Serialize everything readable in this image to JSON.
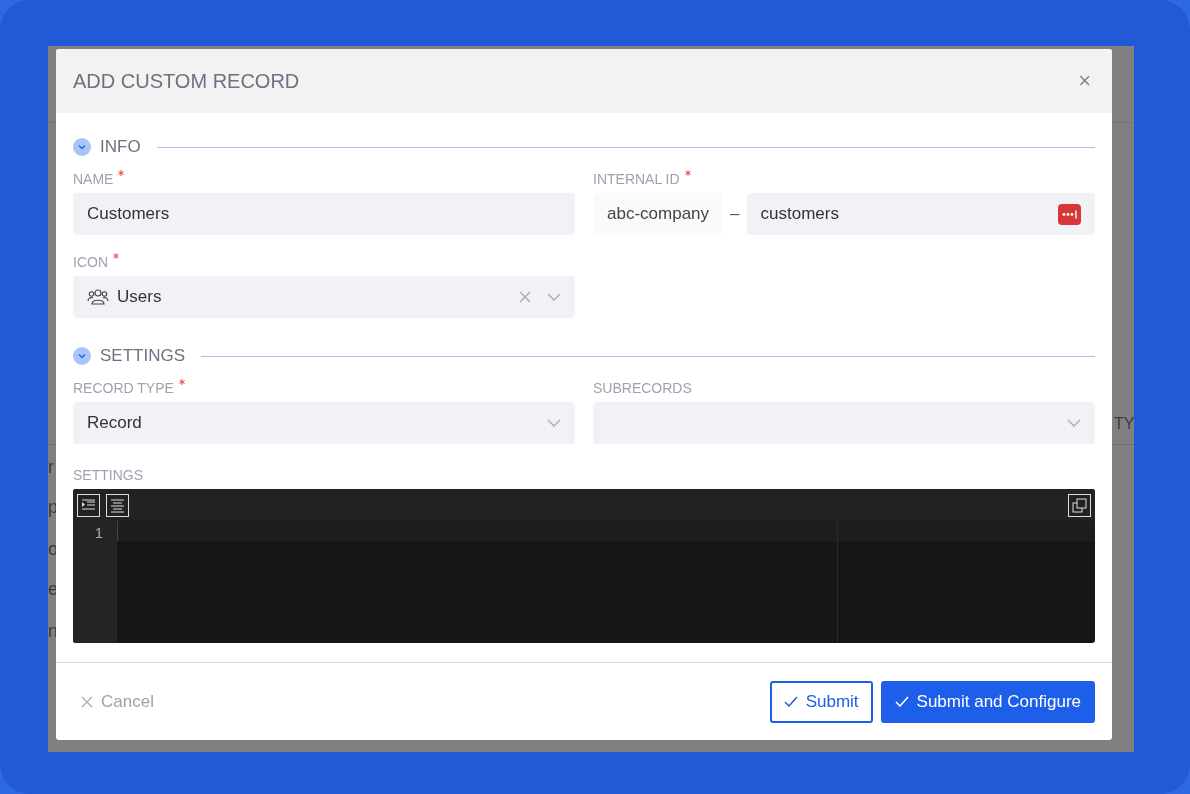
{
  "backdrop_left_letters": [
    "r",
    "p",
    "o",
    "e",
    "n"
  ],
  "backdrop_right_text": "TY",
  "dialog": {
    "title": "ADD CUSTOM RECORD",
    "close": "×"
  },
  "sections": [
    {
      "title": "INFO",
      "expanded": true,
      "fields": [
        {
          "kind": "text",
          "label": "NAME",
          "required": true,
          "value": "Customers"
        },
        {
          "kind": "internal_id",
          "label": "INTERNAL ID",
          "required": true,
          "prefix": "abc-company",
          "separator": "–",
          "value": "customers"
        },
        {
          "kind": "select",
          "label": "ICON",
          "required": true,
          "value": "Users",
          "has_icon": true,
          "clearable": true
        }
      ]
    },
    {
      "title": "SETTINGS",
      "expanded": true,
      "fields": [
        {
          "kind": "select",
          "label": "RECORD TYPE",
          "required": true,
          "value": "Record",
          "clearable": false
        },
        {
          "kind": "select",
          "label": "SUBRECORDS",
          "required": false,
          "clearable": false
        },
        {
          "kind": "editor",
          "label": "SETTINGS",
          "required": false,
          "line_numbers": [
            "1"
          ]
        }
      ]
    }
  ],
  "footer": {
    "cancel": "Cancel",
    "buttons": [
      {
        "kind": "outline",
        "label": "Submit"
      },
      {
        "kind": "primary",
        "label": "Submit and Configure"
      }
    ]
  }
}
